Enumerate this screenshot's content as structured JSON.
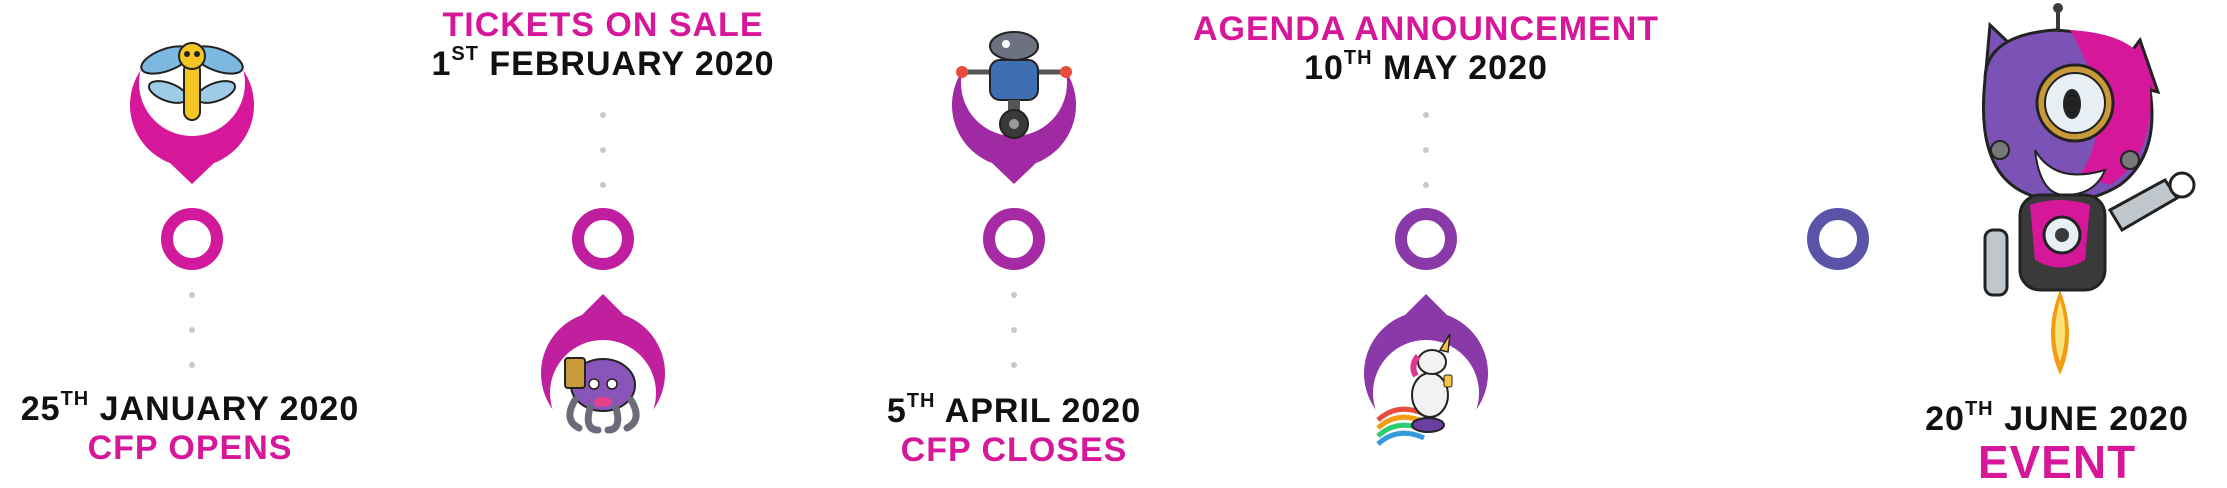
{
  "colors": {
    "start": "#d6179a",
    "mid": "#9b2da6",
    "end": "#5a53a8",
    "title": "#d6179a",
    "dot": "#c9c9c9"
  },
  "milestones": [
    {
      "date_day": "25",
      "date_ordinal": "TH",
      "date_rest": " JANUARY 2020",
      "title": "CFP OPENS",
      "label_side": "below",
      "pin_side": "above",
      "mascot": "dragonfly-icon"
    },
    {
      "date_day": "1",
      "date_ordinal": "ST",
      "date_rest": " FEBRUARY 2020",
      "title": "TICKETS ON SALE",
      "label_side": "above",
      "pin_side": "below",
      "mascot": "octopus-icon"
    },
    {
      "date_day": "5",
      "date_ordinal": "TH",
      "date_rest": " APRIL 2020",
      "title": "CFP CLOSES",
      "label_side": "below",
      "pin_side": "above",
      "mascot": "robot-icon"
    },
    {
      "date_day": "10",
      "date_ordinal": "TH",
      "date_rest": " MAY 2020",
      "title": "AGENDA ANNOUNCEMENT",
      "label_side": "above",
      "pin_side": "below",
      "mascot": "unicorn-icon"
    },
    {
      "date_day": "20",
      "date_ordinal": "TH",
      "date_rest": " JUNE 2020",
      "title": "EVENT",
      "label_side": "below",
      "pin_side": "none",
      "mascot": "cat-robot-icon"
    }
  ]
}
